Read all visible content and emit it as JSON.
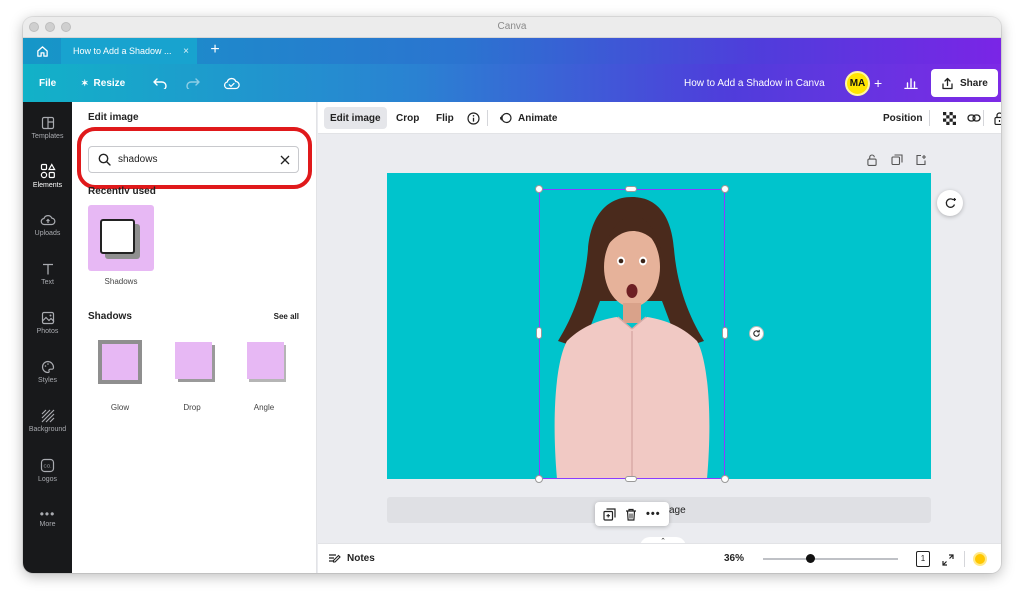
{
  "window": {
    "title": "Canva"
  },
  "tabs": {
    "active_label": "How to Add a Shadow ...",
    "close": "×",
    "new_tab": "+"
  },
  "toolbar": {
    "file": "File",
    "resize": "Resize",
    "doc_title": "How to Add a Shadow in Canva",
    "avatar_initials": "MA",
    "add": "+",
    "share": "Share"
  },
  "rail": {
    "items": [
      {
        "label": "Templates",
        "icon": "template-icon"
      },
      {
        "label": "Elements",
        "icon": "elements-icon"
      },
      {
        "label": "Uploads",
        "icon": "upload-cloud-icon"
      },
      {
        "label": "Text",
        "icon": "text-icon"
      },
      {
        "label": "Photos",
        "icon": "photos-icon"
      },
      {
        "label": "Styles",
        "icon": "palette-icon"
      },
      {
        "label": "Background",
        "icon": "background-icon"
      },
      {
        "label": "Logos",
        "icon": "logos-icon"
      },
      {
        "label": "More",
        "icon": "more-icon"
      }
    ],
    "active_index": 1
  },
  "panel": {
    "title": "Edit image",
    "search_value": "shadows",
    "recently_used_heading": "Recently used",
    "recent_items": [
      {
        "label": "Shadows"
      }
    ],
    "shadows_heading": "Shadows",
    "see_all": "See all",
    "shadow_items": [
      {
        "label": "Glow"
      },
      {
        "label": "Drop"
      },
      {
        "label": "Angle"
      }
    ]
  },
  "context_toolbar": {
    "edit_image": "Edit image",
    "crop": "Crop",
    "flip": "Flip",
    "animate": "Animate",
    "position": "Position"
  },
  "page": {
    "add_page_label": "age"
  },
  "bottom": {
    "notes": "Notes",
    "zoom": "36%",
    "zoom_level": 0.36,
    "page_number": "1"
  },
  "colors": {
    "accent": "#00c4cc",
    "selection": "#8b3dff",
    "highlight": "#e0191b",
    "rail_bg": "#18191b",
    "tile_bg": "#e7b8f4",
    "avatar": "#ffe500"
  }
}
